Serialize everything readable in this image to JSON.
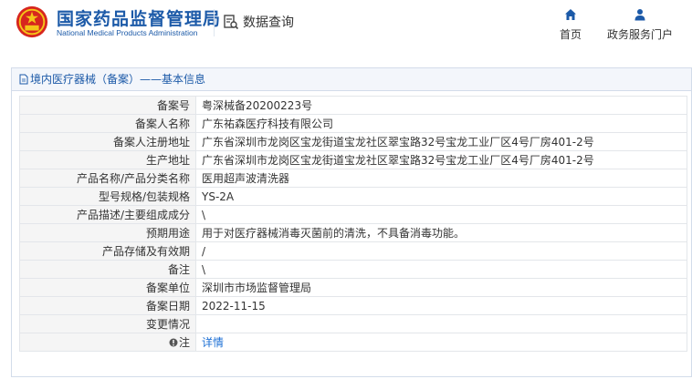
{
  "header": {
    "brand_cn": "国家药品监督管理局",
    "brand_en": "National Medical Products Administration",
    "query_label": "数据查询",
    "nav": [
      {
        "label": "首页",
        "icon": "home-icon"
      },
      {
        "label": "政务服务门户",
        "icon": "user-icon"
      }
    ]
  },
  "panel": {
    "title": "境内医疗器械（备案）——基本信息"
  },
  "rows": [
    {
      "label": "备案号",
      "value": "粤深械备20200223号"
    },
    {
      "label": "备案人名称",
      "value": "广东祐森医疗科技有限公司"
    },
    {
      "label": "备案人注册地址",
      "value": "广东省深圳市龙岗区宝龙街道宝龙社区翠宝路32号宝龙工业厂区4号厂房401-2号"
    },
    {
      "label": "生产地址",
      "value": "广东省深圳市龙岗区宝龙街道宝龙社区翠宝路32号宝龙工业厂区4号厂房401-2号"
    },
    {
      "label": "产品名称/产品分类名称",
      "value": "医用超声波清洗器"
    },
    {
      "label": "型号规格/包装规格",
      "value": "YS-2A"
    },
    {
      "label": "产品描述/主要组成成分",
      "value": "\\"
    },
    {
      "label": "预期用途",
      "value": "用于对医疗器械消毒灭菌前的清洗，不具备消毒功能。"
    },
    {
      "label": "产品存储及有效期",
      "value": "/"
    },
    {
      "label": "备注",
      "value": "\\"
    },
    {
      "label": "备案单位",
      "value": "深圳市市场监督管理局"
    },
    {
      "label": "备案日期",
      "value": "2022-11-15"
    },
    {
      "label": "变更情况",
      "value": ""
    },
    {
      "label": "注",
      "value": "详情"
    }
  ],
  "colors": {
    "brand": "#1c5aa8",
    "emblem_red": "#d7261e",
    "link": "#1c6fd4"
  }
}
